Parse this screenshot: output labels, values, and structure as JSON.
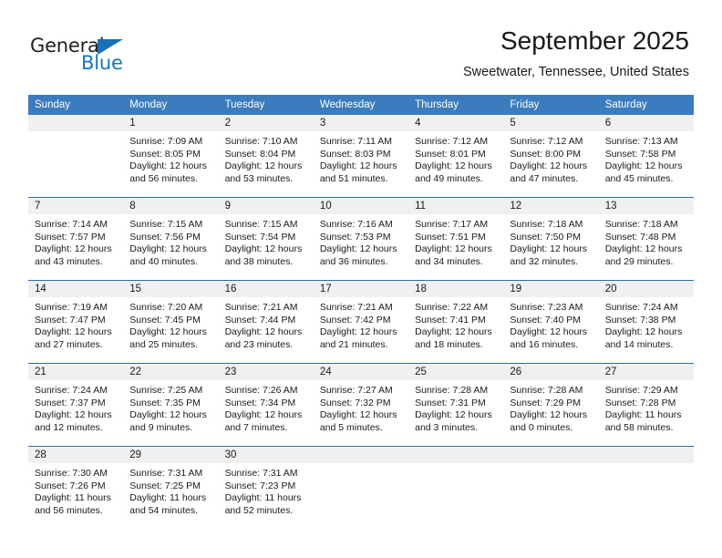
{
  "brand": {
    "name_primary": "General",
    "name_secondary": "Blue",
    "logo_icon": "triangle-logo-icon",
    "accent_color": "#1277bf"
  },
  "header": {
    "title": "September 2025",
    "subtitle": "Sweetwater, Tennessee, United States"
  },
  "calendar": {
    "header_bg": "#3a7cbe",
    "daynum_bg": "#f0f0f0",
    "row_border_color": "#2a6cad",
    "weekdays": [
      "Sunday",
      "Monday",
      "Tuesday",
      "Wednesday",
      "Thursday",
      "Friday",
      "Saturday"
    ],
    "weeks": [
      [
        {
          "day": "",
          "sunrise": "",
          "sunset": "",
          "daylight_line1": "",
          "daylight_line2": "",
          "empty": true
        },
        {
          "day": "1",
          "sunrise": "Sunrise: 7:09 AM",
          "sunset": "Sunset: 8:05 PM",
          "daylight_line1": "Daylight: 12 hours",
          "daylight_line2": "and 56 minutes."
        },
        {
          "day": "2",
          "sunrise": "Sunrise: 7:10 AM",
          "sunset": "Sunset: 8:04 PM",
          "daylight_line1": "Daylight: 12 hours",
          "daylight_line2": "and 53 minutes."
        },
        {
          "day": "3",
          "sunrise": "Sunrise: 7:11 AM",
          "sunset": "Sunset: 8:03 PM",
          "daylight_line1": "Daylight: 12 hours",
          "daylight_line2": "and 51 minutes."
        },
        {
          "day": "4",
          "sunrise": "Sunrise: 7:12 AM",
          "sunset": "Sunset: 8:01 PM",
          "daylight_line1": "Daylight: 12 hours",
          "daylight_line2": "and 49 minutes."
        },
        {
          "day": "5",
          "sunrise": "Sunrise: 7:12 AM",
          "sunset": "Sunset: 8:00 PM",
          "daylight_line1": "Daylight: 12 hours",
          "daylight_line2": "and 47 minutes."
        },
        {
          "day": "6",
          "sunrise": "Sunrise: 7:13 AM",
          "sunset": "Sunset: 7:58 PM",
          "daylight_line1": "Daylight: 12 hours",
          "daylight_line2": "and 45 minutes."
        }
      ],
      [
        {
          "day": "7",
          "sunrise": "Sunrise: 7:14 AM",
          "sunset": "Sunset: 7:57 PM",
          "daylight_line1": "Daylight: 12 hours",
          "daylight_line2": "and 43 minutes."
        },
        {
          "day": "8",
          "sunrise": "Sunrise: 7:15 AM",
          "sunset": "Sunset: 7:56 PM",
          "daylight_line1": "Daylight: 12 hours",
          "daylight_line2": "and 40 minutes."
        },
        {
          "day": "9",
          "sunrise": "Sunrise: 7:15 AM",
          "sunset": "Sunset: 7:54 PM",
          "daylight_line1": "Daylight: 12 hours",
          "daylight_line2": "and 38 minutes."
        },
        {
          "day": "10",
          "sunrise": "Sunrise: 7:16 AM",
          "sunset": "Sunset: 7:53 PM",
          "daylight_line1": "Daylight: 12 hours",
          "daylight_line2": "and 36 minutes."
        },
        {
          "day": "11",
          "sunrise": "Sunrise: 7:17 AM",
          "sunset": "Sunset: 7:51 PM",
          "daylight_line1": "Daylight: 12 hours",
          "daylight_line2": "and 34 minutes."
        },
        {
          "day": "12",
          "sunrise": "Sunrise: 7:18 AM",
          "sunset": "Sunset: 7:50 PM",
          "daylight_line1": "Daylight: 12 hours",
          "daylight_line2": "and 32 minutes."
        },
        {
          "day": "13",
          "sunrise": "Sunrise: 7:18 AM",
          "sunset": "Sunset: 7:48 PM",
          "daylight_line1": "Daylight: 12 hours",
          "daylight_line2": "and 29 minutes."
        }
      ],
      [
        {
          "day": "14",
          "sunrise": "Sunrise: 7:19 AM",
          "sunset": "Sunset: 7:47 PM",
          "daylight_line1": "Daylight: 12 hours",
          "daylight_line2": "and 27 minutes."
        },
        {
          "day": "15",
          "sunrise": "Sunrise: 7:20 AM",
          "sunset": "Sunset: 7:45 PM",
          "daylight_line1": "Daylight: 12 hours",
          "daylight_line2": "and 25 minutes."
        },
        {
          "day": "16",
          "sunrise": "Sunrise: 7:21 AM",
          "sunset": "Sunset: 7:44 PM",
          "daylight_line1": "Daylight: 12 hours",
          "daylight_line2": "and 23 minutes."
        },
        {
          "day": "17",
          "sunrise": "Sunrise: 7:21 AM",
          "sunset": "Sunset: 7:42 PM",
          "daylight_line1": "Daylight: 12 hours",
          "daylight_line2": "and 21 minutes."
        },
        {
          "day": "18",
          "sunrise": "Sunrise: 7:22 AM",
          "sunset": "Sunset: 7:41 PM",
          "daylight_line1": "Daylight: 12 hours",
          "daylight_line2": "and 18 minutes."
        },
        {
          "day": "19",
          "sunrise": "Sunrise: 7:23 AM",
          "sunset": "Sunset: 7:40 PM",
          "daylight_line1": "Daylight: 12 hours",
          "daylight_line2": "and 16 minutes."
        },
        {
          "day": "20",
          "sunrise": "Sunrise: 7:24 AM",
          "sunset": "Sunset: 7:38 PM",
          "daylight_line1": "Daylight: 12 hours",
          "daylight_line2": "and 14 minutes."
        }
      ],
      [
        {
          "day": "21",
          "sunrise": "Sunrise: 7:24 AM",
          "sunset": "Sunset: 7:37 PM",
          "daylight_line1": "Daylight: 12 hours",
          "daylight_line2": "and 12 minutes."
        },
        {
          "day": "22",
          "sunrise": "Sunrise: 7:25 AM",
          "sunset": "Sunset: 7:35 PM",
          "daylight_line1": "Daylight: 12 hours",
          "daylight_line2": "and 9 minutes."
        },
        {
          "day": "23",
          "sunrise": "Sunrise: 7:26 AM",
          "sunset": "Sunset: 7:34 PM",
          "daylight_line1": "Daylight: 12 hours",
          "daylight_line2": "and 7 minutes."
        },
        {
          "day": "24",
          "sunrise": "Sunrise: 7:27 AM",
          "sunset": "Sunset: 7:32 PM",
          "daylight_line1": "Daylight: 12 hours",
          "daylight_line2": "and 5 minutes."
        },
        {
          "day": "25",
          "sunrise": "Sunrise: 7:28 AM",
          "sunset": "Sunset: 7:31 PM",
          "daylight_line1": "Daylight: 12 hours",
          "daylight_line2": "and 3 minutes."
        },
        {
          "day": "26",
          "sunrise": "Sunrise: 7:28 AM",
          "sunset": "Sunset: 7:29 PM",
          "daylight_line1": "Daylight: 12 hours",
          "daylight_line2": "and 0 minutes."
        },
        {
          "day": "27",
          "sunrise": "Sunrise: 7:29 AM",
          "sunset": "Sunset: 7:28 PM",
          "daylight_line1": "Daylight: 11 hours",
          "daylight_line2": "and 58 minutes."
        }
      ],
      [
        {
          "day": "28",
          "sunrise": "Sunrise: 7:30 AM",
          "sunset": "Sunset: 7:26 PM",
          "daylight_line1": "Daylight: 11 hours",
          "daylight_line2": "and 56 minutes."
        },
        {
          "day": "29",
          "sunrise": "Sunrise: 7:31 AM",
          "sunset": "Sunset: 7:25 PM",
          "daylight_line1": "Daylight: 11 hours",
          "daylight_line2": "and 54 minutes."
        },
        {
          "day": "30",
          "sunrise": "Sunrise: 7:31 AM",
          "sunset": "Sunset: 7:23 PM",
          "daylight_line1": "Daylight: 11 hours",
          "daylight_line2": "and 52 minutes."
        },
        {
          "day": "",
          "sunrise": "",
          "sunset": "",
          "daylight_line1": "",
          "daylight_line2": "",
          "empty": true
        },
        {
          "day": "",
          "sunrise": "",
          "sunset": "",
          "daylight_line1": "",
          "daylight_line2": "",
          "empty": true
        },
        {
          "day": "",
          "sunrise": "",
          "sunset": "",
          "daylight_line1": "",
          "daylight_line2": "",
          "empty": true
        },
        {
          "day": "",
          "sunrise": "",
          "sunset": "",
          "daylight_line1": "",
          "daylight_line2": "",
          "empty": true
        }
      ]
    ]
  }
}
